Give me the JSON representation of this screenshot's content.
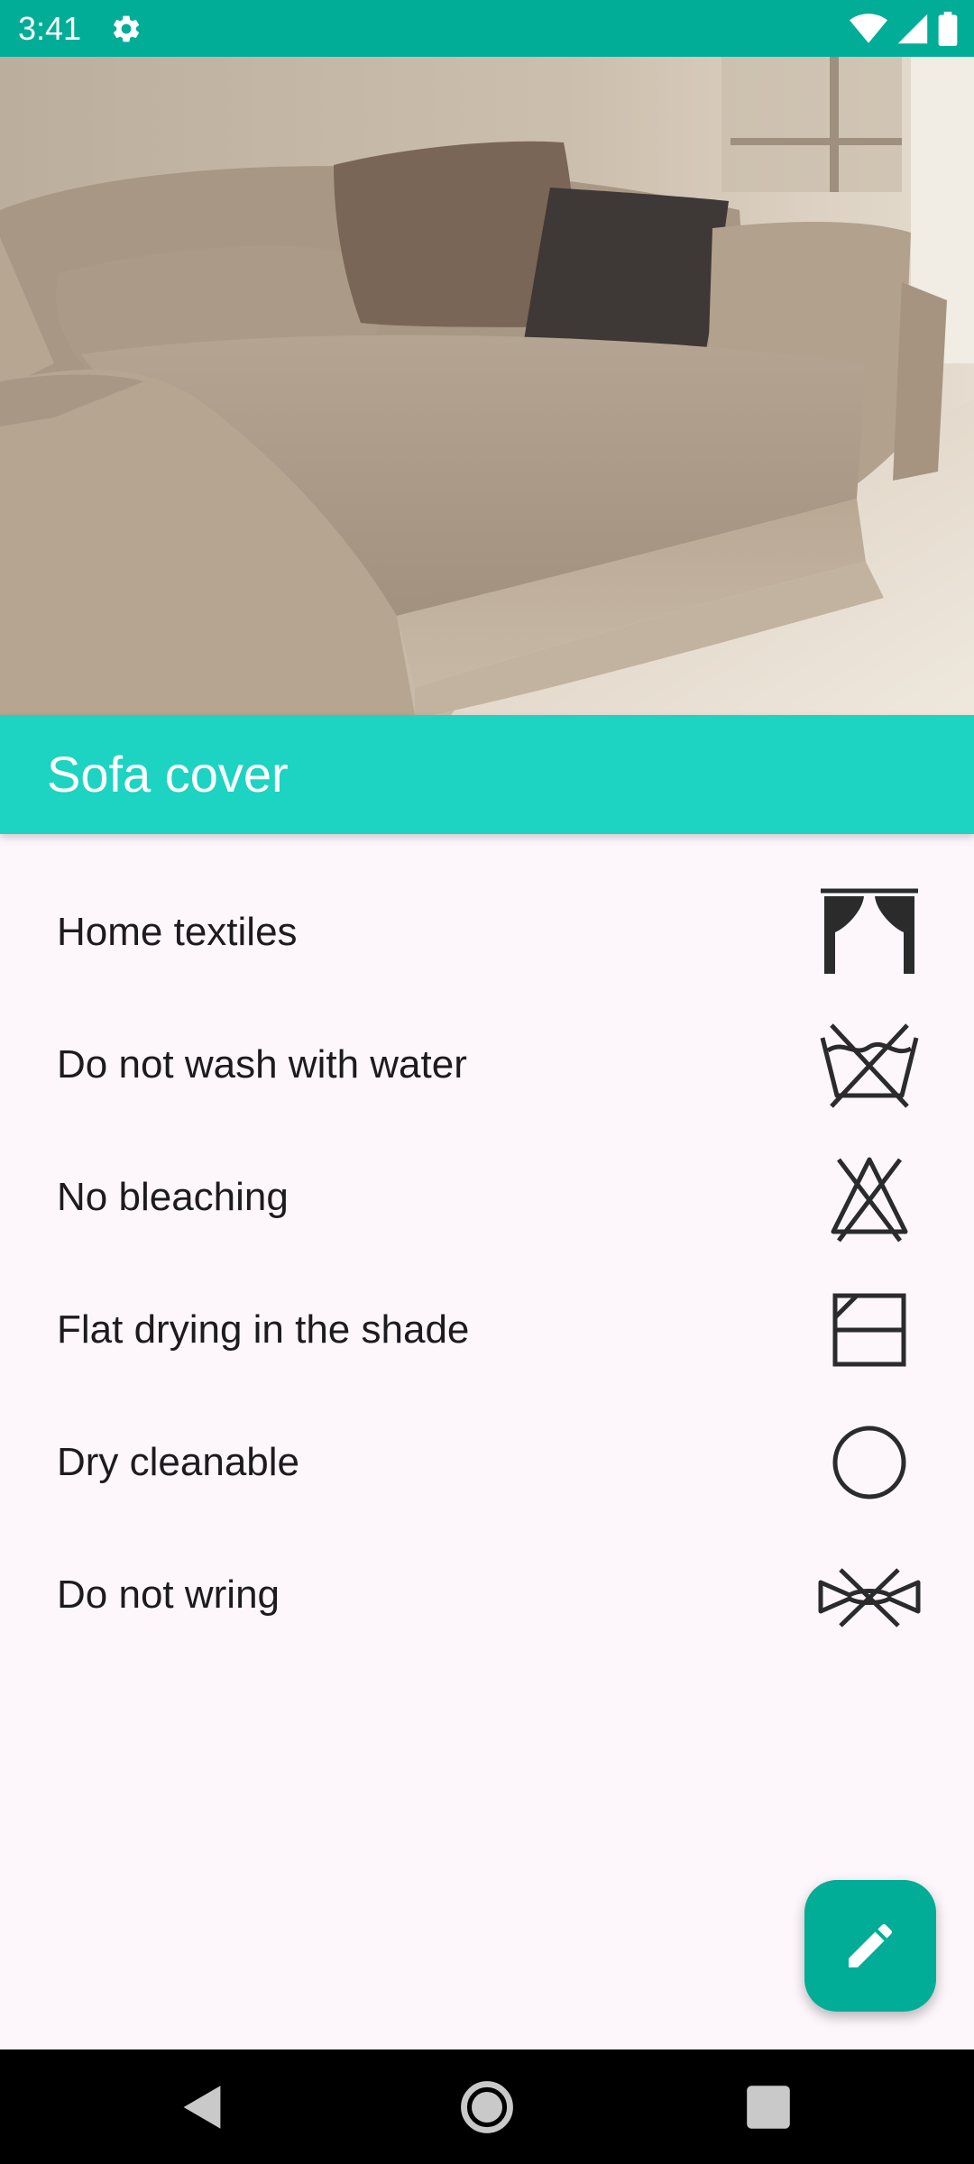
{
  "status_bar": {
    "time": "3:41",
    "settings_icon": "gear-icon",
    "wifi_icon": "wifi-icon",
    "signal_icon": "cell-signal-icon",
    "battery_icon": "battery-icon",
    "background_color": "#02ad97"
  },
  "hero": {
    "image": "sofa-photo"
  },
  "header": {
    "title": "Sofa cover",
    "background_color": "#1dd3c2"
  },
  "care_items": [
    {
      "label": "Home textiles",
      "icon": "curtain-icon"
    },
    {
      "label": "Do not wash with water",
      "icon": "do-not-wash-icon"
    },
    {
      "label": "No bleaching",
      "icon": "no-bleach-icon"
    },
    {
      "label": "Flat drying in the shade",
      "icon": "dry-flat-shade-icon"
    },
    {
      "label": "Dry cleanable",
      "icon": "dry-clean-icon"
    },
    {
      "label": "Do not wring",
      "icon": "do-not-wring-icon"
    }
  ],
  "fab": {
    "icon": "edit-pencil-icon",
    "background_color": "#02ad97"
  },
  "nav_bar": {
    "back_icon": "back-icon",
    "home_icon": "home-icon",
    "recents_icon": "recents-icon"
  }
}
